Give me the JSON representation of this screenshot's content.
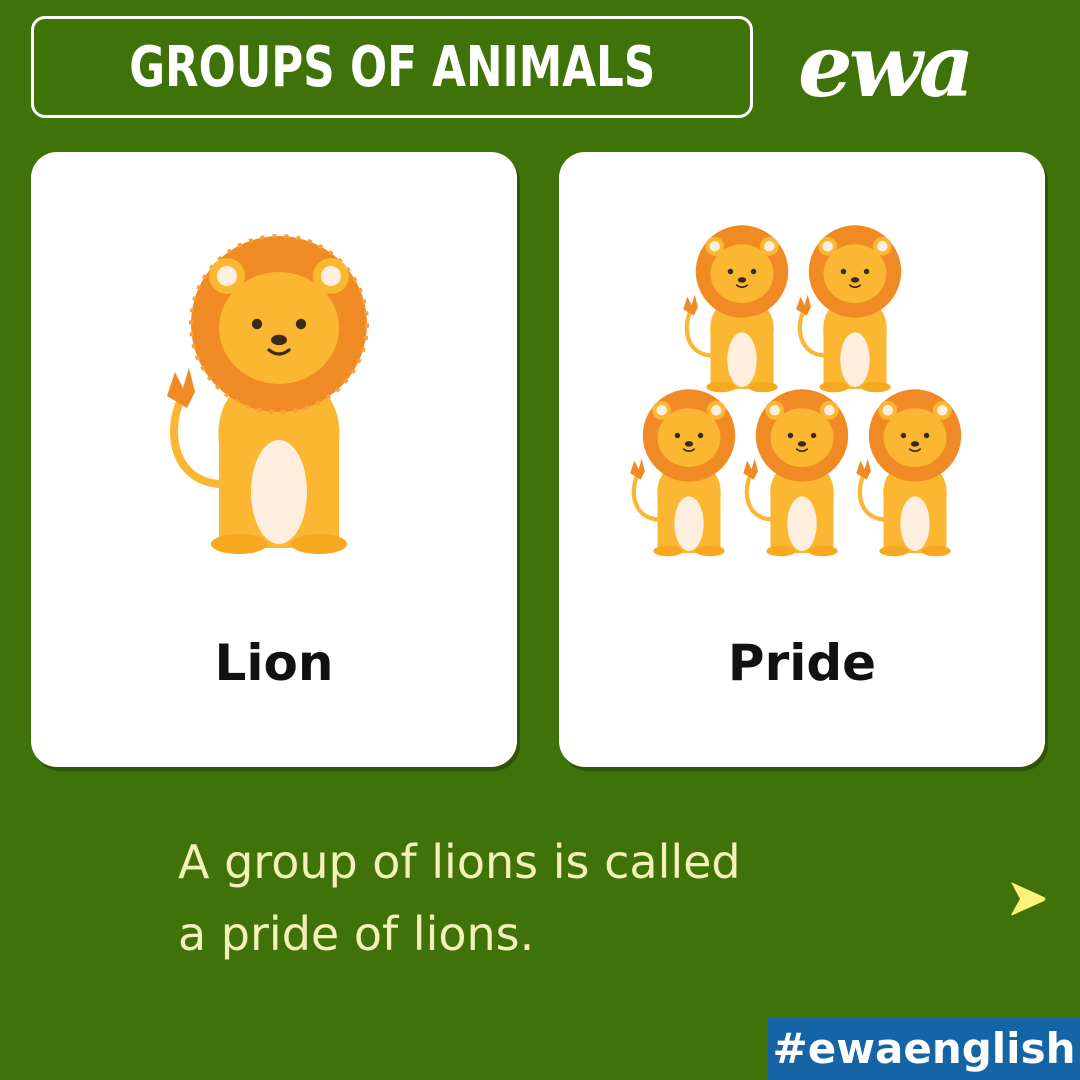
{
  "header": {
    "title": "GROUPS OF ANIMALS",
    "logo_text": "ewa"
  },
  "cards": [
    {
      "label": "Lion",
      "icon": "lion-icon"
    },
    {
      "label": "Pride",
      "icon": "lion-group-icon"
    }
  ],
  "caption": {
    "line1": "A group of lions is called",
    "line2": "a pride of lions."
  },
  "nav": {
    "icon": "play-triangle-icon"
  },
  "hashtag": "#ewaenglish",
  "colors": {
    "background": "#3f7208",
    "card": "#ffffff",
    "caption_text": "#f3f0b8",
    "hashtag_bg": "#1565a6",
    "lion_mane": "#ef8a25",
    "lion_body": "#fbb731",
    "lion_belly": "#fdeede"
  }
}
